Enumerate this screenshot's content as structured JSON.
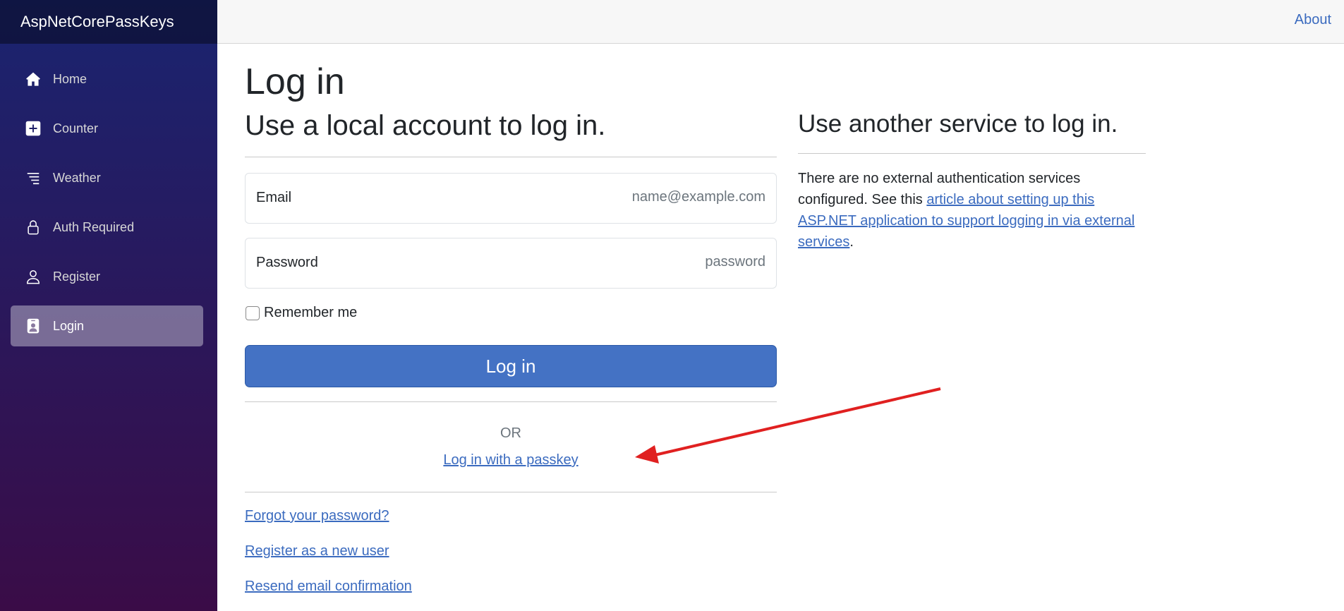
{
  "sidebar": {
    "brand": "AspNetCorePassKeys",
    "items": [
      {
        "label": "Home",
        "icon": "home-icon"
      },
      {
        "label": "Counter",
        "icon": "plus-square-icon"
      },
      {
        "label": "Weather",
        "icon": "list-icon"
      },
      {
        "label": "Auth Required",
        "icon": "lock-icon"
      },
      {
        "label": "Register",
        "icon": "person-icon"
      },
      {
        "label": "Login",
        "icon": "person-badge-icon",
        "active": true
      }
    ]
  },
  "top_row": {
    "about": "About"
  },
  "main": {
    "title": "Log in",
    "local": {
      "heading": "Use a local account to log in.",
      "email_label": "Email",
      "email_placeholder": "name@example.com",
      "email_value": "",
      "password_label": "Password",
      "password_placeholder": "password",
      "password_value": "",
      "remember_label": "Remember me",
      "remember_checked": false,
      "login_button": "Log in",
      "or_text": "OR",
      "passkey_link": "Log in with a passkey",
      "forgot_link": "Forgot your password?",
      "register_link": "Register as a new user",
      "resend_link": "Resend email confirmation"
    },
    "external": {
      "heading": "Use another service to log in.",
      "text_before": "There are no external authentication services configured. See this ",
      "link_text": "article about setting up this ASP.NET application to support logging in via external services",
      "text_after": "."
    }
  },
  "colors": {
    "sidebar_top": "#1a2470",
    "sidebar_bottom": "#3a0c47",
    "primary_button": "#4472c4",
    "link": "#3b6bbf",
    "annotation_arrow": "#e02020"
  }
}
